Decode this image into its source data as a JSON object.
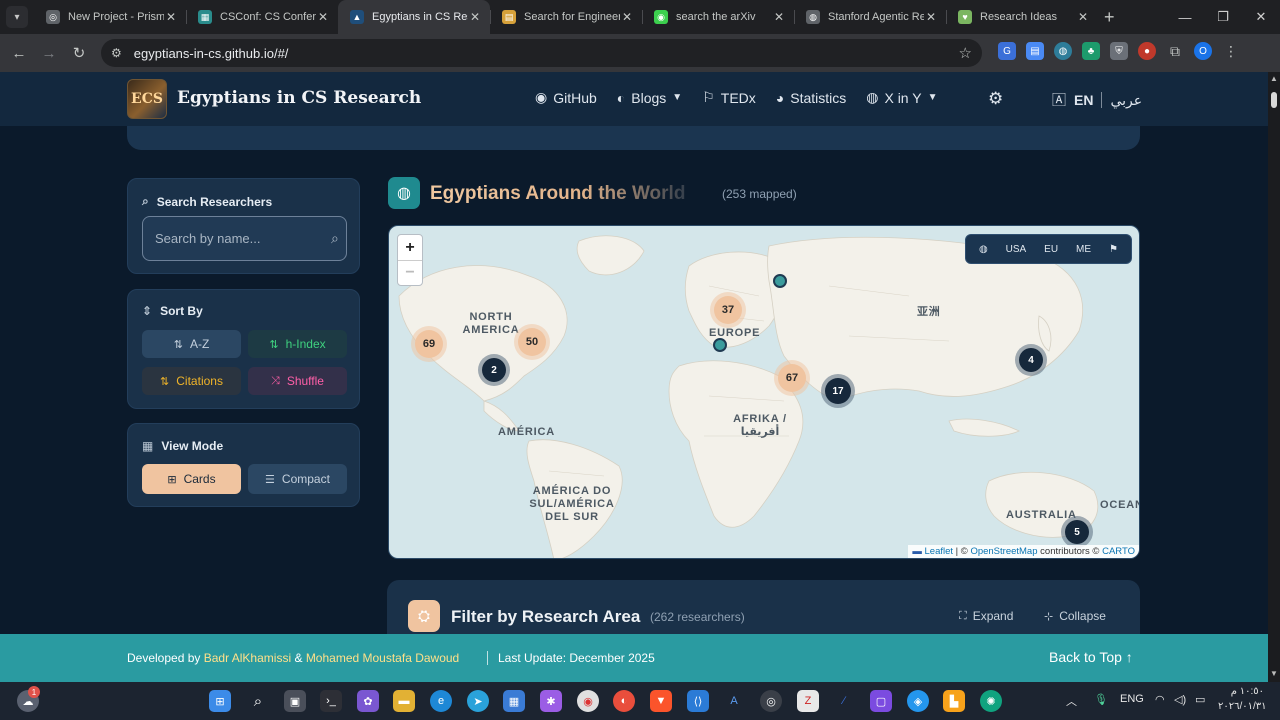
{
  "browser": {
    "tabs": [
      {
        "title": "New Project - Prism",
        "icon": "prism-icon",
        "color": "#5f6368",
        "active": false
      },
      {
        "title": "CSConf: CS Conferences",
        "icon": "csconf-icon",
        "color": "#2a8c8c",
        "active": false
      },
      {
        "title": "Egyptians in CS Research",
        "icon": "egy-icon",
        "color": "#1f4e7a",
        "active": true
      },
      {
        "title": "Search for Engineering",
        "icon": "search-engine-icon",
        "color": "#d6a13a",
        "active": false
      },
      {
        "title": "search the arXiv",
        "icon": "arxiv-icon",
        "color": "#3ccf4e",
        "active": false
      },
      {
        "title": "Stanford Agentic Review",
        "icon": "globe-icon",
        "color": "#5f6368",
        "active": false
      },
      {
        "title": "Research Ideas",
        "icon": "ideas-icon",
        "color": "#7bb661",
        "active": false
      }
    ],
    "url": "egyptians-in-cs.github.io/#/"
  },
  "site": {
    "brand": "Egyptians in CS Research",
    "logo_text": "ECS",
    "nav": {
      "github": "GitHub",
      "blogs": "Blogs",
      "tedx": "TEDx",
      "statistics": "Statistics",
      "xiny": "X in Y"
    },
    "lang_en": "EN",
    "lang_ar": "عربي"
  },
  "sidebar": {
    "search": {
      "title": "Search Researchers",
      "placeholder": "Search by name..."
    },
    "sort": {
      "title": "Sort By",
      "az": "A-Z",
      "hindex": "h-Index",
      "citations": "Citations",
      "shuffle": "Shuffle"
    },
    "view": {
      "title": "View Mode",
      "cards": "Cards",
      "compact": "Compact"
    }
  },
  "map_section": {
    "title": "Egyptians Around the World",
    "count": "(253 mapped)",
    "zoom_in": "+",
    "zoom_out": "−",
    "regions": {
      "usa": "USA",
      "eu": "EU",
      "me": "ME"
    },
    "labels": {
      "north_america": "NORTH AMERICA",
      "europe": "EUROPE",
      "america": "AMÉRICA",
      "south_america": "AMÉRICA DO SUL/AMÉRICA DEL SUR",
      "africa": "AFRIKA / أفريقيا",
      "asia": "亚洲",
      "australia": "AUSTRALIA",
      "ocean": "OCEAN"
    },
    "clusters": {
      "na_west": "69",
      "na_east": "50",
      "na_south": "2",
      "europe": "37",
      "middle_east": "67",
      "gulf": "17",
      "east_asia": "4",
      "australia": "5"
    },
    "attribution": {
      "leaflet": "Leaflet",
      "osm": "OpenStreetMap",
      "contributors": "contributors ©",
      "carto": "CARTO"
    }
  },
  "filter": {
    "title": "Filter by Research Area",
    "count": "(262 researchers)",
    "expand": "Expand",
    "collapse": "Collapse"
  },
  "footer": {
    "developed_by": "Developed by",
    "author1": "Badr AlKhamissi",
    "amp": "&",
    "author2": "Mohamed Moustafa Dawoud",
    "last_update": "Last Update: December 2025",
    "back_to_top": "Back to Top"
  },
  "taskbar": {
    "lang": "ENG",
    "time": "١٠:٥٠ م",
    "date": "٢٠٢٦/٠١/٣١",
    "badge": "1"
  },
  "colors": {
    "accent_teal": "#2a9ba1",
    "accent_tan": "#f0c4a0",
    "page_bg": "#0b1a2b"
  }
}
